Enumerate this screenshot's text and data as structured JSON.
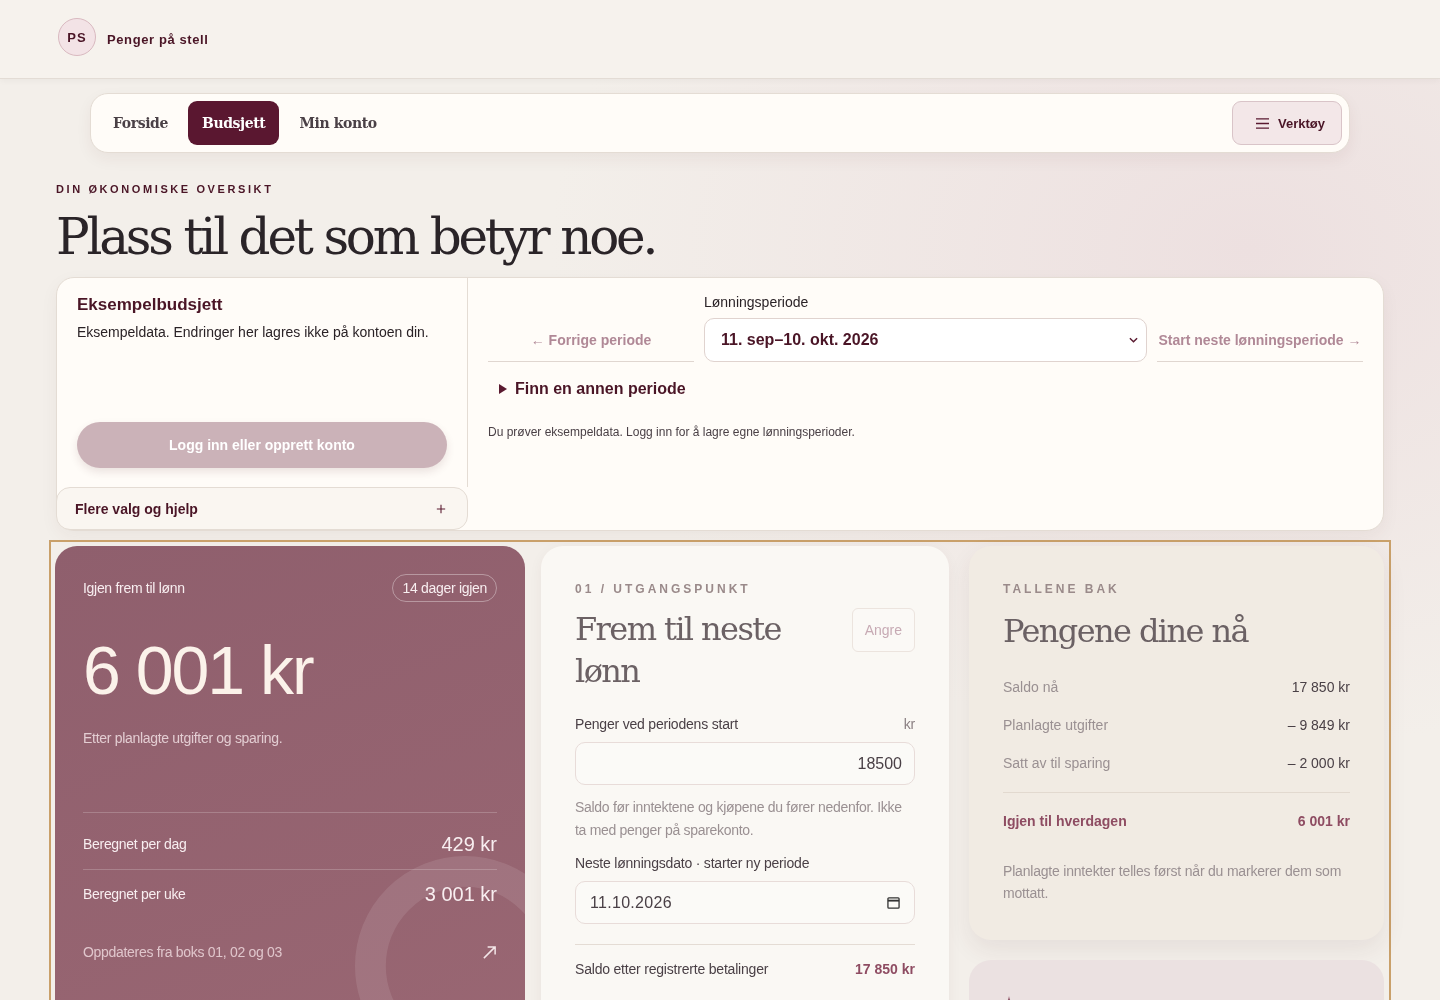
{
  "brand": {
    "initials": "PS",
    "name": "Penger på stell"
  },
  "nav": {
    "tabs": [
      {
        "label": "Forside",
        "selected": false
      },
      {
        "label": "Budsjett",
        "selected": true
      },
      {
        "label": "Min konto",
        "selected": false
      }
    ],
    "tools_button": "Verktøy"
  },
  "eyebrow": "DIN ØKONOMISKE OVERSIKT",
  "title": "Plass til det som betyr noe.",
  "demo_panel": {
    "title": "Eksempelbudsjett",
    "text": "Eksempeldata. Endringer her lagres ikke på kontoen din.",
    "login_button": "Logg inn eller opprett konto",
    "more_help": {
      "label": "Flere valg og hjelp",
      "expanded": false
    }
  },
  "period_panel": {
    "prev_link": "← Forrige periode",
    "label": "Lønningsperiode",
    "select_value": "11. sep–10. okt. 2026",
    "next_link": "Start neste lønningsperiode →",
    "finder": {
      "label": "Finn en annen periode",
      "expanded": false
    },
    "note": "Du prøver eksempeldata. Logg inn for å lagre egne lønningsperioder."
  },
  "remaining_card": {
    "label": "Igjen frem til lønn",
    "badge": "14 dager igjen",
    "amount": "6 001 kr",
    "subtitle": "Etter planlagte utgifter og sparing.",
    "rows": [
      {
        "label": "Beregnet per dag",
        "value": "429 kr"
      },
      {
        "label": "Beregnet per uke",
        "value": "3 001 kr"
      }
    ],
    "footer": "Oppdateres fra boks 01, 02 og 03"
  },
  "start_card": {
    "eyebrow": "01 / UTGANGSPUNKT",
    "title": "Frem til neste lønn",
    "undo_button": "Angre",
    "amount_label": "Penger ved periodens start",
    "amount_unit": "kr",
    "amount_value": "18500",
    "hint": "Saldo før inntektene og kjøpene du fører nedenfor. Ikke ta med penger på sparekonto.",
    "date_label": "Neste lønningsdato · starter ny periode",
    "date_value": "11.10.2026",
    "summary": {
      "label": "Saldo etter registrerte betalinger",
      "value": "17 850 kr"
    }
  },
  "numbers_card": {
    "eyebrow": "TALLENE BAK",
    "title": "Pengene dine nå",
    "rows": [
      {
        "kind": "line",
        "label": "Saldo nå",
        "value": "17 850 kr"
      },
      {
        "kind": "line",
        "label": "Planlagte utgifter",
        "value": "– 9 849 kr"
      },
      {
        "kind": "line",
        "label": "Satt av til sparing",
        "value": "– 2 000 kr"
      },
      {
        "kind": "total",
        "label": "Igjen til hverdagen",
        "value": "6 001 kr"
      }
    ],
    "note": "Planlagte inntekter telles først når du markerer dem som mottatt."
  }
}
